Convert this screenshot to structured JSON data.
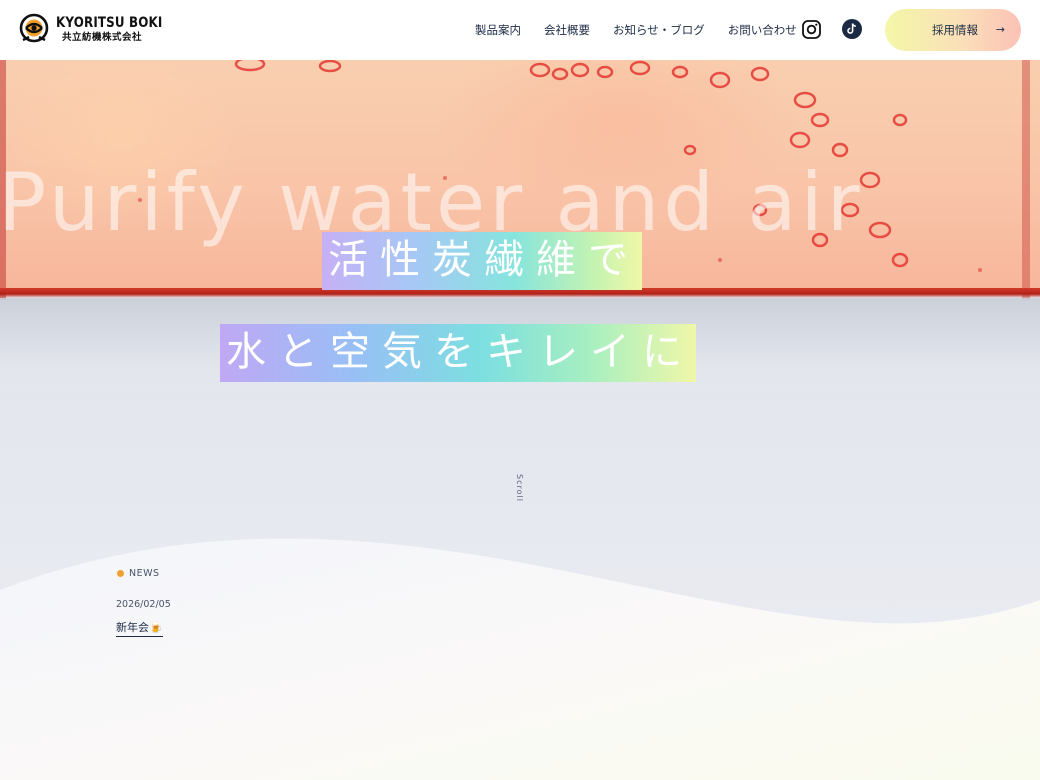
{
  "header": {
    "logo_en": "KYORITSU BOKI",
    "logo_jp": "共立紡機株式会社",
    "nav": [
      "製品案内",
      "会社概要",
      "お知らせ・ブログ",
      "お問い合わせ"
    ],
    "recruit_label": "採用情報",
    "recruit_arrow": "→",
    "icons": [
      "instagram-icon",
      "tiktok-icon",
      "arrow-right-icon"
    ]
  },
  "hero": {
    "bg_text": "Purify water and air",
    "catch_line_1": "活性炭繊維で",
    "catch_line_2": "水と空気をキレイに",
    "scroll_label": "Scroll"
  },
  "news": {
    "heading": "NEWS",
    "items": [
      {
        "date": "2026/02/05",
        "title": "新年会🍺"
      }
    ]
  },
  "colors": {
    "text": "#1c2b45",
    "accent_dot": "#f0a030",
    "recruit_gradient": [
      "#f4f7a8",
      "#fae0b8",
      "#fcc2b6"
    ],
    "catch_gradient": [
      "#c6b0f5",
      "#a5c9f5",
      "#86e4dd",
      "#c4f3b1",
      "#f0f7a8"
    ]
  }
}
